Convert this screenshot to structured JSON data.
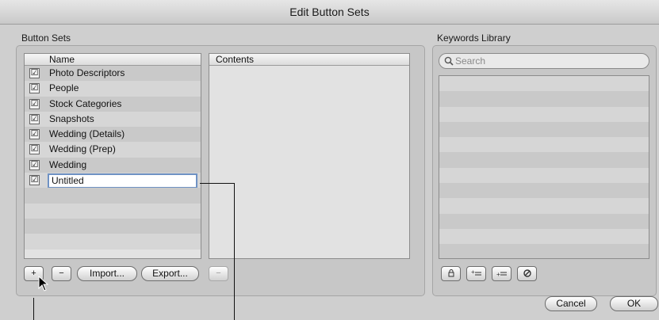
{
  "window": {
    "title": "Edit Button Sets"
  },
  "button_sets": {
    "section_label": "Button Sets",
    "columns": {
      "name": "Name",
      "contents": "Contents"
    },
    "rows": [
      {
        "name": "Photo Descriptors",
        "checked": true
      },
      {
        "name": "People",
        "checked": true
      },
      {
        "name": "Stock Categories",
        "checked": true
      },
      {
        "name": "Snapshots",
        "checked": true
      },
      {
        "name": "Wedding (Details)",
        "checked": true
      },
      {
        "name": "Wedding (Prep)",
        "checked": true
      },
      {
        "name": "Wedding",
        "checked": true
      },
      {
        "name": "Untitled",
        "checked": true,
        "editing": true
      }
    ],
    "buttons": {
      "add": "+",
      "remove": "−",
      "import": "Import...",
      "export": "Export...",
      "contents_remove": "−"
    }
  },
  "keywords_library": {
    "section_label": "Keywords Library",
    "search_placeholder": "Search",
    "toolbar_icons": [
      "lock-icon",
      "add-keyword-icon",
      "add-subkeyword-icon",
      "remove-keyword-icon"
    ]
  },
  "dialog_buttons": {
    "cancel": "Cancel",
    "ok": "OK"
  },
  "check_glyph": "☑"
}
